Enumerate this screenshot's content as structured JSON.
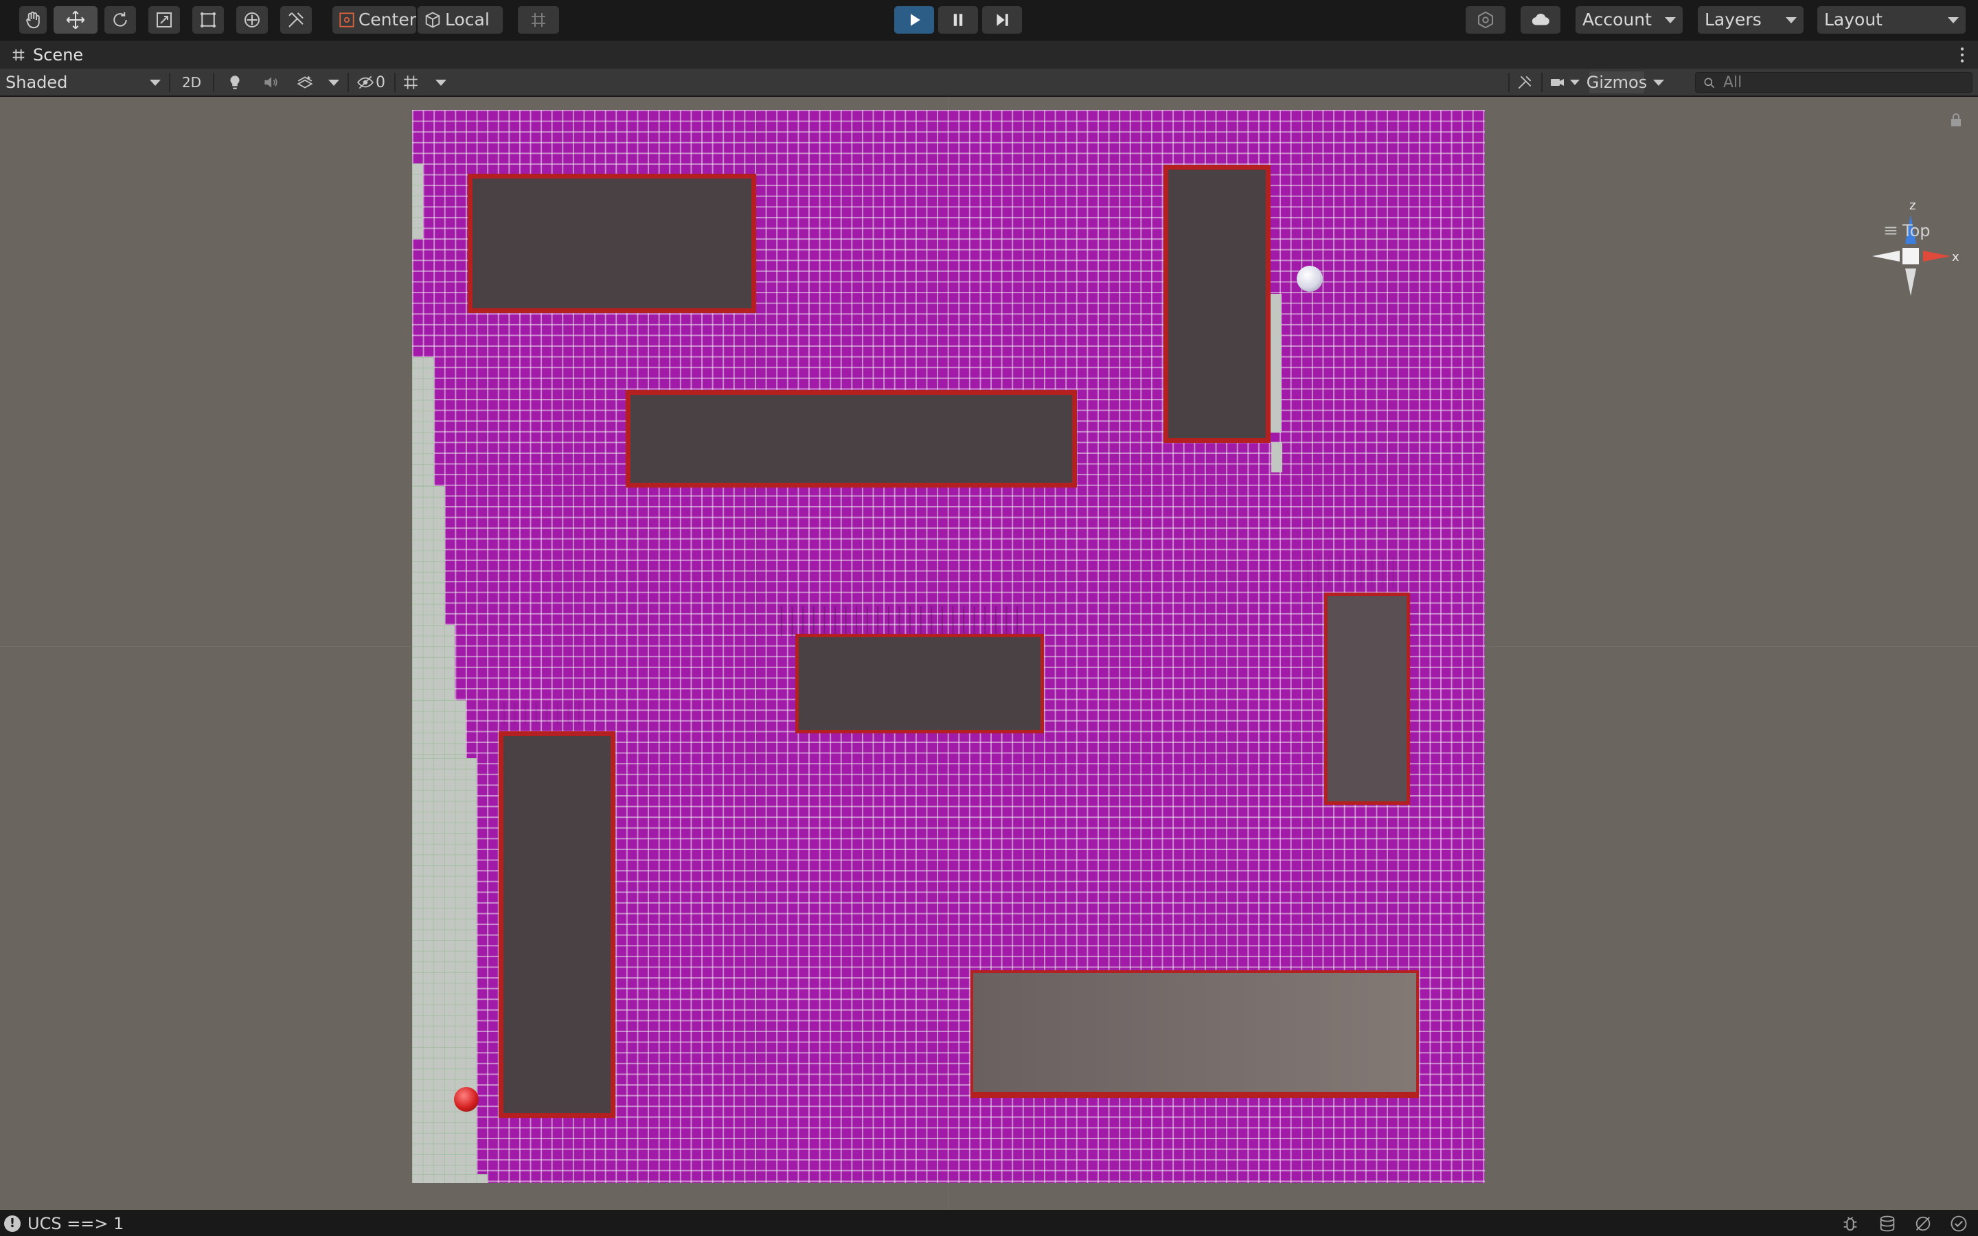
{
  "toolbar": {
    "tools": [
      {
        "name": "hand-tool-icon"
      },
      {
        "name": "move-tool-icon"
      },
      {
        "name": "rotate-tool-icon"
      },
      {
        "name": "scale-tool-icon"
      },
      {
        "name": "rect-tool-icon"
      },
      {
        "name": "transform-tool-icon"
      },
      {
        "name": "custom-tool-icon"
      }
    ],
    "pivot_mode": "Center",
    "pivot_rotation": "Local",
    "account_label": "Account",
    "layers_label": "Layers",
    "layout_label": "Layout"
  },
  "tab": {
    "title": "Scene"
  },
  "scene_toolbar": {
    "draw_mode": "Shaded",
    "mode_2d": "2D",
    "hidden_count": "0",
    "gizmos_label": "Gizmos",
    "search_placeholder": "All"
  },
  "gizmo": {
    "z": "z",
    "x": "x",
    "view_label": "Top"
  },
  "status": {
    "message": "UCS ==> 1"
  },
  "colors": {
    "floor": "#a21aa8",
    "obstacle": "#4a4145",
    "obstacle_border": "#b42020",
    "explored_path": "#c3c7c1",
    "agent": "#d42020",
    "goal": "#e8e8f0",
    "play_button": "#2c5d87"
  }
}
